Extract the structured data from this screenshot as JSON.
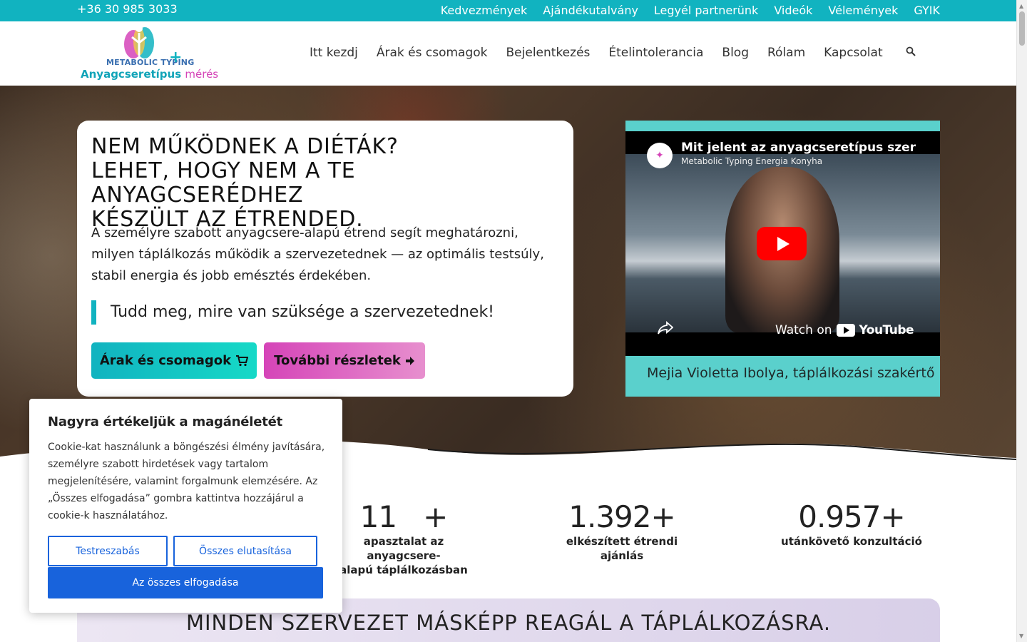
{
  "topbar": {
    "phone": "+36 30 985 3033",
    "links": [
      "Kedvezmények",
      "Ajándékutalvány",
      "Legyél partnerünk",
      "Videók",
      "Vélemények",
      "GYIK"
    ]
  },
  "logo": {
    "small_text": "METABOLIC TYPING",
    "plus": "+",
    "big_text": "Anyagcseretípus",
    "big_text_pink": "mérés"
  },
  "nav": {
    "items": [
      "Itt kezdj",
      "Árak és csomagok",
      "Bejelentkezés",
      "Ételintolerancia",
      "Blog",
      "Rólam",
      "Kapcsolat"
    ],
    "search_icon": "search-icon"
  },
  "hero": {
    "title_line1": "NEM MŰKÖDNEK A DIÉTÁK?",
    "title_line2": "LEHET, HOGY NEM A TE ANYAGCSERÉDHEZ",
    "title_line3": "KÉSZÜLT AZ ÉTRENDED.",
    "description": "A személyre szabott anyagcsere-alapú étrend segít meghatározni, milyen táplálkozás működik a szervezetednek — az optimális testsúly, stabil energia és jobb emésztés érdekében.",
    "quote": "Tudd meg, mire van szüksége a szervezetednek!",
    "btn_prices": "Árak és csomagok",
    "btn_more": "További részletek"
  },
  "video": {
    "title": "Mit jelent az anyagcseretípus szerinti táplálkozás?",
    "channel": "Metabolic Typing Energia Konyha",
    "watch_on": "Watch on",
    "youtube": "YouTube",
    "caption": "Mejia Violetta Ibolya, táplálkozási szakértő"
  },
  "stats": [
    {
      "number": "11",
      "suffix": "+",
      "label": "apasztalat az anyagcsere-",
      "label2": "alapú táplálkozásban"
    },
    {
      "number": "1.392",
      "suffix": "+",
      "label": "elkészített étrendi ajánlás"
    },
    {
      "number": "0.957",
      "suffix": "+",
      "label": "utánkövető konzultáció"
    }
  ],
  "banner": {
    "title": "MINDEN SZERVEZET MÁSKÉPP REAGÁL A TÁPLÁLKOZÁSRA."
  },
  "cookie": {
    "title": "Nagyra értékeljük a magánéletét",
    "text": "Cookie-kat használunk a böngészési élmény javítására, személyre szabott hirdetések vagy tartalom megjelenítésére, valamint forgalmunk elemzésére. Az „Összes elfogadása” gombra kattintva hozzájárul a cookie-k használatához.",
    "customize": "Testreszabás",
    "reject": "Összes elutasítása",
    "accept": "Az összes elfogadása"
  },
  "colors": {
    "accent_teal": "#11b3c0",
    "accent_pink": "#d544b8",
    "cookie_blue": "#1863dc"
  }
}
